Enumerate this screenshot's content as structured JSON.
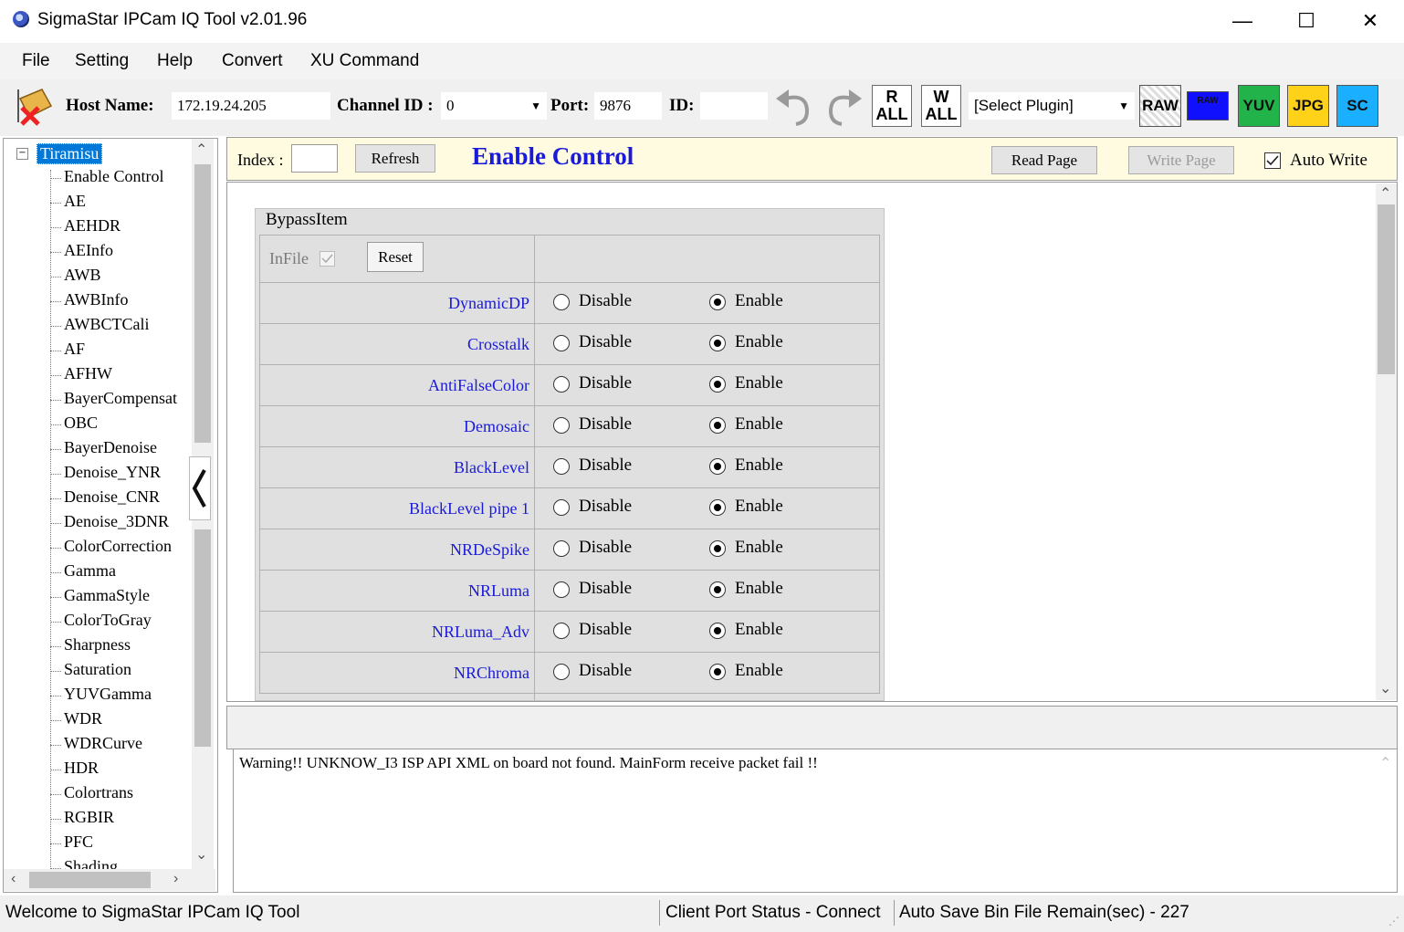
{
  "window": {
    "title": "SigmaStar IPCam IQ Tool v2.01.96",
    "minimize": "—",
    "maximize": "☐",
    "close": "✕"
  },
  "menu": [
    "File",
    "Setting",
    "Help",
    "Convert",
    "XU Command"
  ],
  "toolbar": {
    "host_label": "Host Name:",
    "host_value": "172.19.24.205",
    "channel_label": "Channel ID :",
    "channel_value": "0",
    "port_label": "Port:",
    "port_value": "9876",
    "id_label": "ID:",
    "id_value": "",
    "read_all": [
      "R",
      "ALL"
    ],
    "write_all": [
      "W",
      "ALL"
    ],
    "plugin_select": "[Select Plugin]",
    "format_buttons": [
      "RAW",
      "RAW",
      "YUV",
      "JPG",
      "SC"
    ]
  },
  "tree": {
    "root": "Tiramisu",
    "items": [
      "Enable Control",
      "AE",
      "AEHDR",
      "AEInfo",
      "AWB",
      "AWBInfo",
      "AWBCTCali",
      "AF",
      "AFHW",
      "BayerCompensat",
      "OBC",
      "BayerDenoise",
      "Denoise_YNR",
      "Denoise_CNR",
      "Denoise_3DNR",
      "ColorCorrection",
      "Gamma",
      "GammaStyle",
      "ColorToGray",
      "Sharpness",
      "Saturation",
      "YUVGamma",
      "WDR",
      "WDRCurve",
      "HDR",
      "Colortrans",
      "RGBIR",
      "PFC",
      "Shading"
    ]
  },
  "header": {
    "index_label": "Index :",
    "index_value": "",
    "refresh": "Refresh",
    "page_title": "Enable Control",
    "read_page": "Read Page",
    "write_page": "Write Page",
    "auto_write": "Auto Write",
    "auto_write_checked": true
  },
  "group": {
    "title": "BypassItem",
    "infile_label": "InFile",
    "reset": "Reset",
    "disable_label": "Disable",
    "enable_label": "Enable",
    "rows": [
      {
        "label": "DynamicDP",
        "selected": "Enable"
      },
      {
        "label": "Crosstalk",
        "selected": "Enable"
      },
      {
        "label": "AntiFalseColor",
        "selected": "Enable"
      },
      {
        "label": "Demosaic",
        "selected": "Enable"
      },
      {
        "label": "BlackLevel",
        "selected": "Enable"
      },
      {
        "label": "BlackLevel pipe 1",
        "selected": "Enable"
      },
      {
        "label": "NRDeSpike",
        "selected": "Enable"
      },
      {
        "label": "NRLuma",
        "selected": "Enable"
      },
      {
        "label": "NRLuma_Adv",
        "selected": "Enable"
      },
      {
        "label": "NRChroma",
        "selected": "Enable"
      }
    ]
  },
  "log": {
    "message": "Warning!! UNKNOW_I3 ISP API XML on board not found. MainForm receive packet fail !!"
  },
  "status": {
    "welcome": "Welcome to SigmaStar IPCam IQ Tool",
    "client_port": "Client Port Status - Connect",
    "auto_save": "Auto Save Bin File Remain(sec) - 227"
  },
  "colors": {
    "accent_blue": "#1a1ad9",
    "header_bg": "#fefbe0",
    "selected_tree": "#0078d7"
  }
}
